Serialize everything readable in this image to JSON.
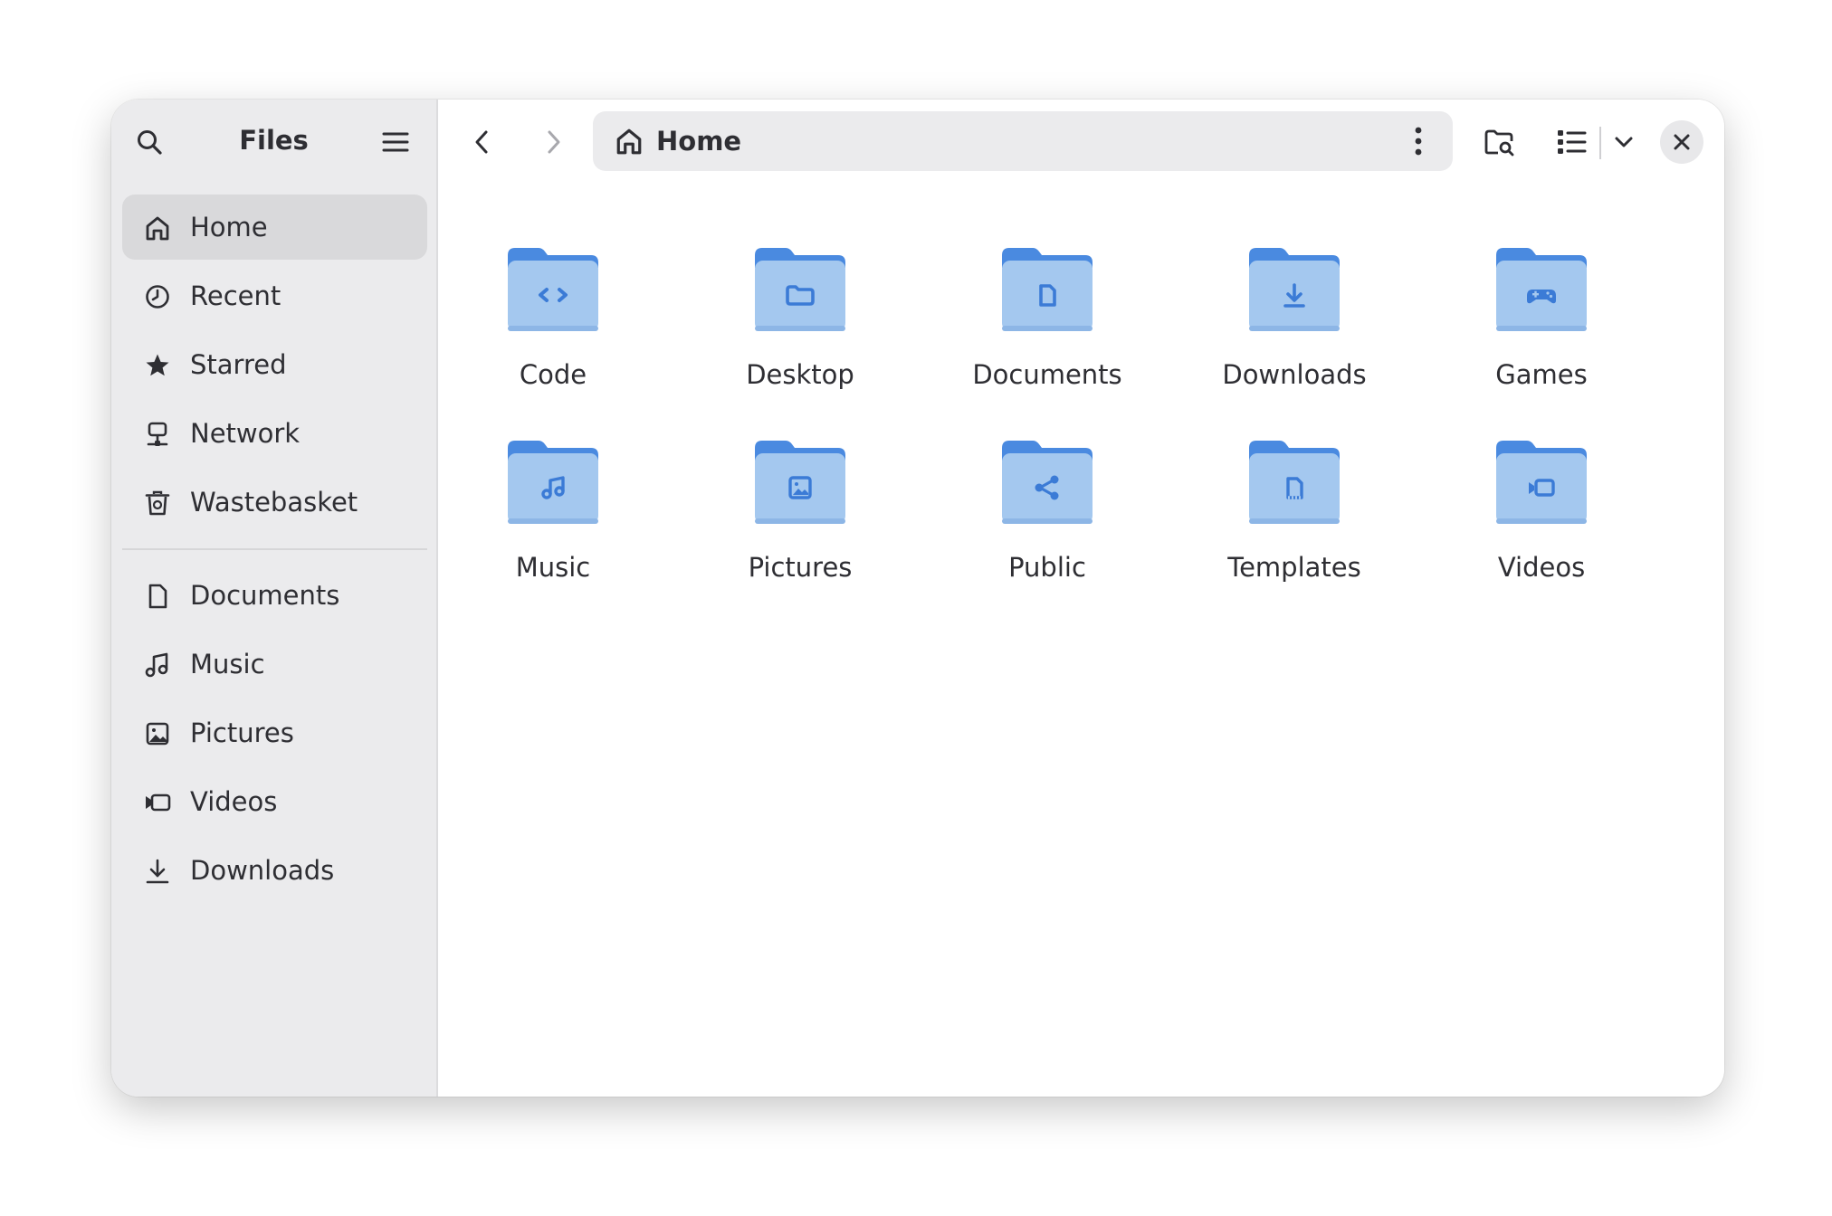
{
  "app": {
    "title": "Files"
  },
  "sidebar": {
    "places": [
      {
        "label": "Home",
        "icon": "home-icon",
        "active": true
      },
      {
        "label": "Recent",
        "icon": "clock-icon",
        "active": false
      },
      {
        "label": "Starred",
        "icon": "star-icon",
        "active": false
      },
      {
        "label": "Network",
        "icon": "network-icon",
        "active": false
      },
      {
        "label": "Wastebasket",
        "icon": "trash-icon",
        "active": false
      }
    ],
    "bookmarks": [
      {
        "label": "Documents",
        "icon": "document-icon"
      },
      {
        "label": "Music",
        "icon": "music-icon"
      },
      {
        "label": "Pictures",
        "icon": "picture-icon"
      },
      {
        "label": "Videos",
        "icon": "video-icon"
      },
      {
        "label": "Downloads",
        "icon": "download-icon"
      }
    ]
  },
  "toolbar": {
    "breadcrumb": "Home"
  },
  "folders": [
    {
      "label": "Code",
      "emblem": "code-icon"
    },
    {
      "label": "Desktop",
      "emblem": "folder-icon"
    },
    {
      "label": "Documents",
      "emblem": "document-icon"
    },
    {
      "label": "Downloads",
      "emblem": "download-icon"
    },
    {
      "label": "Games",
      "emblem": "gamepad-icon"
    },
    {
      "label": "Music",
      "emblem": "music-icon"
    },
    {
      "label": "Pictures",
      "emblem": "picture-icon"
    },
    {
      "label": "Public",
      "emblem": "share-icon"
    },
    {
      "label": "Templates",
      "emblem": "template-icon"
    },
    {
      "label": "Videos",
      "emblem": "video-icon"
    }
  ],
  "colors": {
    "sidebar_bg": "#ebebed",
    "folder_body": "#a4c8ef",
    "folder_tab": "#4a8ae0",
    "folder_emblem": "#3b7bd6",
    "text": "#2e2e33"
  }
}
